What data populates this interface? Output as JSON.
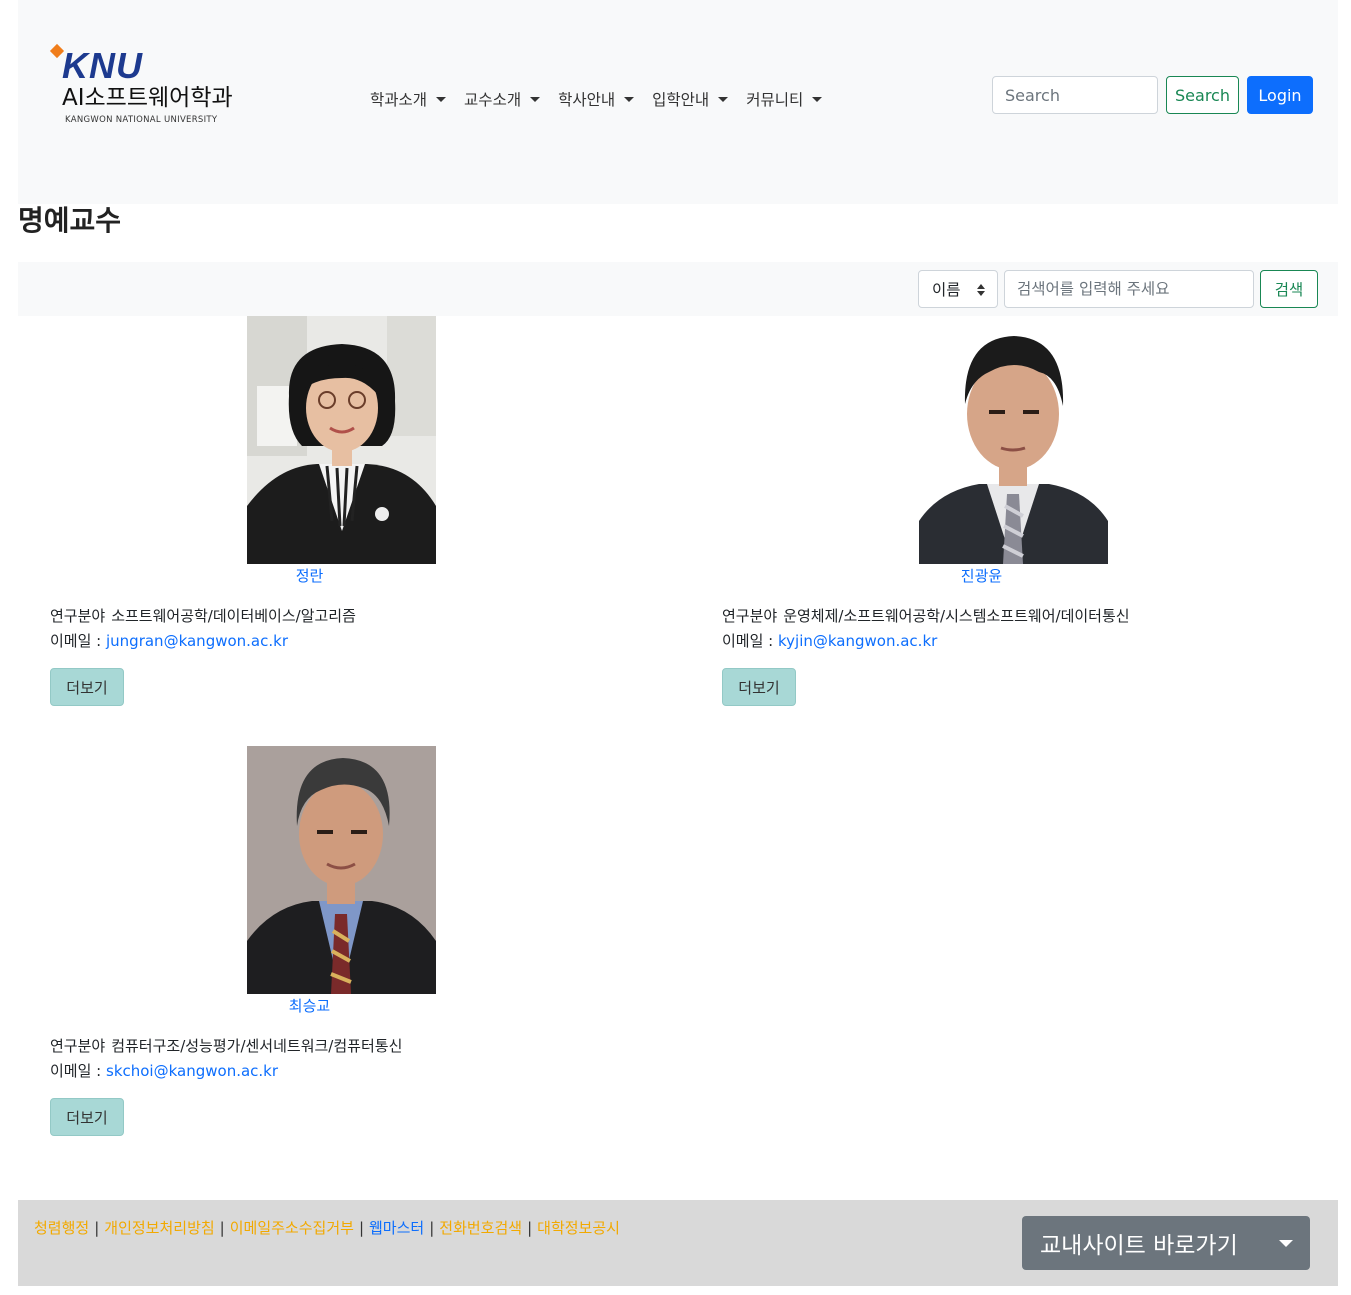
{
  "header": {
    "logo": {
      "brand": "KNU",
      "dept": "AI소프트웨어학과",
      "univ": "KANGWON NATIONAL UNIVERSITY"
    },
    "menu": [
      {
        "label": "학과소개"
      },
      {
        "label": "교수소개"
      },
      {
        "label": "학사안내"
      },
      {
        "label": "입학안내"
      },
      {
        "label": "커뮤니티"
      }
    ],
    "search_placeholder": "Search",
    "search_button": "Search",
    "login_button": "Login"
  },
  "page": {
    "title": "명예교수"
  },
  "filter": {
    "select_value": "이름",
    "input_placeholder": "검색어를 입력해 주세요",
    "button": "검색"
  },
  "professors": [
    {
      "name": "정란",
      "field_label": "연구분야",
      "field": "소프트웨어공학/데이터베이스/알고리즘",
      "email_label": "이메일 : ",
      "email": "jungran@kangwon.ac.kr",
      "more": "더보기"
    },
    {
      "name": "진광윤",
      "field_label": "연구분야",
      "field": "운영체제/소프트웨어공학/시스템소프트웨어/데이터통신",
      "email_label": "이메일 : ",
      "email": "kyjin@kangwon.ac.kr",
      "more": "더보기"
    },
    {
      "name": "최승교",
      "field_label": "연구분야",
      "field": "컴퓨터구조/성능평가/센서네트워크/컴퓨터통신",
      "email_label": "이메일 : ",
      "email": "skchoi@kangwon.ac.kr",
      "more": "더보기"
    }
  ],
  "footer": {
    "links": [
      {
        "label": "청렴행정"
      },
      {
        "label": "개인정보처리방침"
      },
      {
        "label": "이메일주소수집거부"
      },
      {
        "label": "웹마스터"
      },
      {
        "label": "전화번호검색"
      },
      {
        "label": "대학정보공시"
      }
    ],
    "separator": "|",
    "quick_link": "교내사이트 바로가기"
  },
  "colors": {
    "link_blue": "#0d6efd",
    "footer_link_orange": "#f2a900",
    "success_green": "#198754",
    "more_button_bg": "#a8d8d6",
    "logo_blue": "#1d3a8f",
    "logo_orange": "#f07d1a"
  }
}
